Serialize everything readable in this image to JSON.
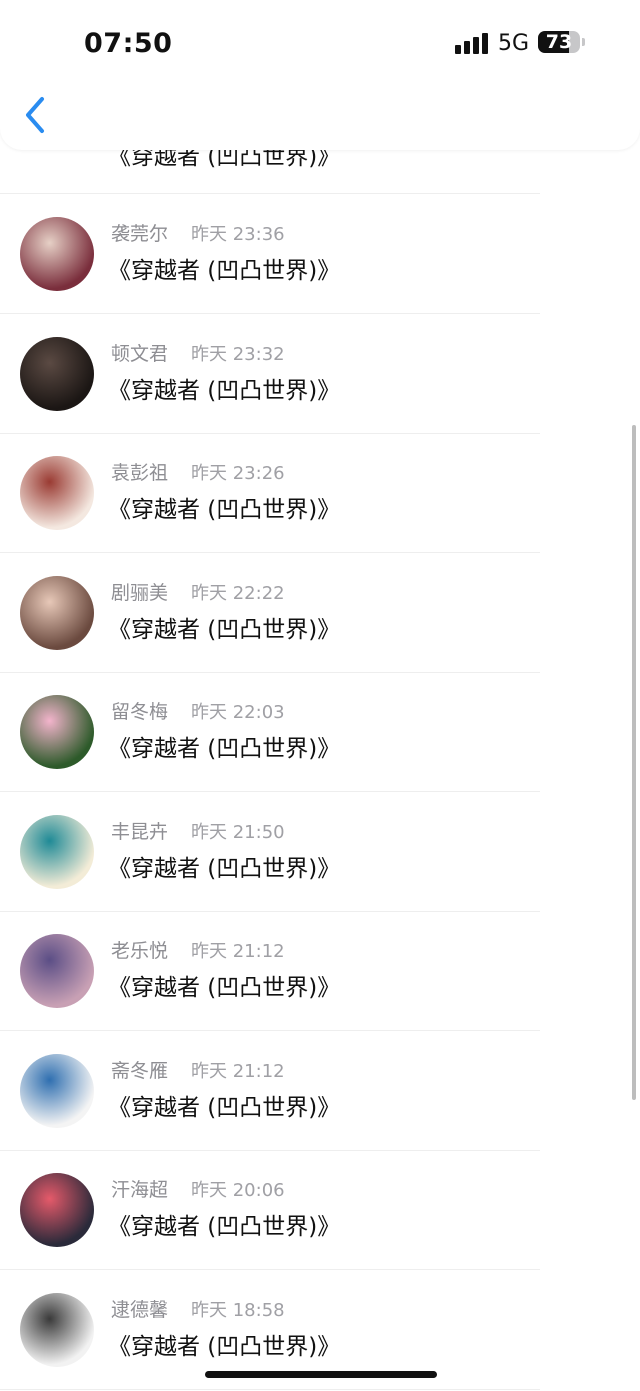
{
  "status_bar": {
    "time": "07:50",
    "network": "5G",
    "battery": "73",
    "battery_level_percent": 73
  },
  "nav": {
    "back_icon": "chevron-left-icon"
  },
  "partial_row": {
    "message": "《穿越者 (凹凸世界)》"
  },
  "rows": [
    {
      "name": "袭莞尔",
      "time": "昨天 23:36",
      "message": "《穿越者 (凹凸世界)》",
      "avatar": "anime-couple-avatar",
      "avatar_colors": [
        "#7a2e3c",
        "#e6d0c6"
      ]
    },
    {
      "name": "顿文君",
      "time": "昨天 23:32",
      "message": "《穿越者 (凹凸世界)》",
      "avatar": "hands-photo-avatar",
      "avatar_colors": [
        "#1b1614",
        "#5b4a43"
      ]
    },
    {
      "name": "袁彭祖",
      "time": "昨天 23:26",
      "message": "《穿越者 (凹凸世界)》",
      "avatar": "sweater-photo-avatar",
      "avatar_colors": [
        "#f4e8e0",
        "#9a3b33"
      ]
    },
    {
      "name": "剧骊美",
      "time": "昨天 22:22",
      "message": "《穿越者 (凹凸世界)》",
      "avatar": "girl-photo-avatar",
      "avatar_colors": [
        "#6b4a3f",
        "#e7c8b8"
      ]
    },
    {
      "name": "留冬梅",
      "time": "昨天 22:03",
      "message": "《穿越者 (凹凸世界)》",
      "avatar": "lotus-avatar",
      "avatar_colors": [
        "#2d5a2a",
        "#f3b4cc"
      ]
    },
    {
      "name": "丰昆卉",
      "time": "昨天 21:50",
      "message": "《穿越者 (凹凸世界)》",
      "avatar": "letter-d-cartoon-avatar",
      "avatar_colors": [
        "#f3ecd7",
        "#1f8a96"
      ]
    },
    {
      "name": "老乐悦",
      "time": "昨天 21:12",
      "message": "《穿越者 (凹凸世界)》",
      "avatar": "anime-girl-avatar",
      "avatar_colors": [
        "#c8a0b4",
        "#5b4e86"
      ]
    },
    {
      "name": "斋冬雁",
      "time": "昨天 21:12",
      "message": "《穿越者 (凹凸世界)》",
      "avatar": "sketch-character-avatar",
      "avatar_colors": [
        "#f4f4f4",
        "#2f6fb0"
      ]
    },
    {
      "name": "汗海超",
      "time": "昨天 20:06",
      "message": "《穿越者 (凹凸世界)》",
      "avatar": "anime-boy-avatar",
      "avatar_colors": [
        "#2a2a3a",
        "#e55a6a"
      ]
    },
    {
      "name": "逮德馨",
      "time": "昨天 18:58",
      "message": "《穿越者 (凹凸世界)》",
      "avatar": "grayscale-portrait-avatar",
      "avatar_colors": [
        "#f2f2f2",
        "#3a3a3a"
      ]
    }
  ]
}
